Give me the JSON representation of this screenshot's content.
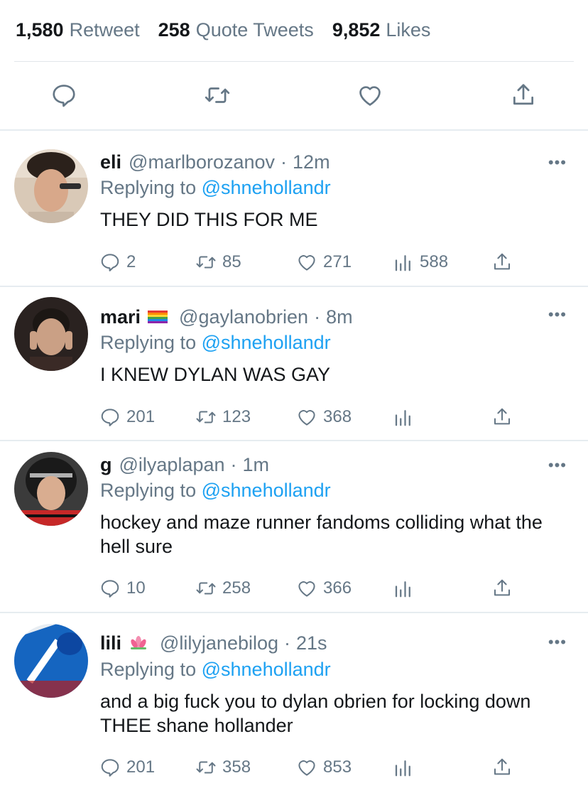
{
  "stats": {
    "retweets": {
      "count": "1,580",
      "label": "Retweet"
    },
    "quotes": {
      "count": "258",
      "label": "Quote Tweets"
    },
    "likes": {
      "count": "9,852",
      "label": "Likes"
    }
  },
  "actions": [
    "comment-icon",
    "retweet-icon",
    "heart-icon",
    "share-icon"
  ],
  "colors": {
    "accent": "#1da1f2",
    "muted": "#657786",
    "text": "#14171a",
    "divider": "#e6ecf0"
  },
  "replies": [
    {
      "name": "eli",
      "handle": "@marlborozanov",
      "time": "12m",
      "replying_prefix": "Replying to",
      "replying_to": "@shnehollandr",
      "text": "THEY DID THIS FOR ME",
      "comments": "2",
      "retweets": "85",
      "likes": "271",
      "views": "588"
    },
    {
      "name": "mari",
      "emoji": "rainbow-flag",
      "handle": "@gaylanobrien",
      "time": "8m",
      "replying_prefix": "Replying to",
      "replying_to": "@shnehollandr",
      "text": "I KNEW DYLAN WAS GAY",
      "comments": "201",
      "retweets": "123",
      "likes": "368",
      "views": ""
    },
    {
      "name": "g",
      "handle": "@ilyaplapan",
      "time": "1m",
      "replying_prefix": "Replying to",
      "replying_to": "@shnehollandr",
      "text": "hockey and maze runner fandoms colliding what the hell sure",
      "comments": "10",
      "retweets": "258",
      "likes": "366",
      "views": ""
    },
    {
      "name": "lili",
      "emoji": "lotus",
      "handle": "@lilyjanebilog",
      "time": "21s",
      "replying_prefix": "Replying to",
      "replying_to": "@shnehollandr",
      "text": "and a big fuck you to dylan obrien for locking down THEE shane hollander",
      "comments": "201",
      "retweets": "358",
      "likes": "853",
      "views": ""
    }
  ]
}
